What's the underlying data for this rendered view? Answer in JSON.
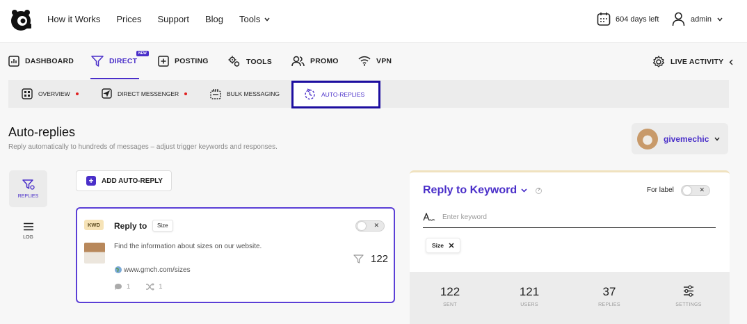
{
  "topbar": {
    "links": [
      "How it Works",
      "Prices",
      "Support",
      "Blog",
      "Tools"
    ],
    "days_left": "604 days left",
    "user": "admin"
  },
  "mainnav": {
    "items": [
      "DASHBOARD",
      "DIRECT",
      "POSTING",
      "TOOLS",
      "PROMO",
      "VPN"
    ],
    "badge": "NEW",
    "live_activity": "LIVE ACTIVITY"
  },
  "subnav": {
    "items": [
      "OVERVIEW",
      "DIRECT MESSENGER",
      "BULK MESSAGING",
      "AUTO-REPLIES"
    ]
  },
  "page": {
    "title": "Auto-replies",
    "subtitle": "Reply automatically to hundreds of messages – adjust trigger keywords and responses."
  },
  "account": {
    "name": "givemechic"
  },
  "sidebar": {
    "replies": "REPLIES",
    "log": "LOG"
  },
  "add_button": "ADD AUTO-REPLY",
  "card": {
    "kwd": "KWD",
    "title": "Reply to",
    "chip": "Size",
    "message": "Find the information about sizes on our website.",
    "link": "www.gmch.com/sizes",
    "comments": "1",
    "shuffle": "1",
    "count": "122"
  },
  "panel": {
    "title": "Reply to Keyword",
    "help": "?",
    "for_label": "For label",
    "keyword_placeholder": "Enter keyword",
    "keyword_chip": "Size",
    "stats": [
      {
        "num": "122",
        "label": "SENT"
      },
      {
        "num": "121",
        "label": "USERS"
      },
      {
        "num": "37",
        "label": "REPLIES"
      },
      {
        "num": "",
        "label": "SETTINGS"
      }
    ]
  },
  "colors": {
    "accent": "#4a2fc9",
    "highlight_box": "#1d0ea0",
    "kwd_badge": "#f6e3b7"
  }
}
